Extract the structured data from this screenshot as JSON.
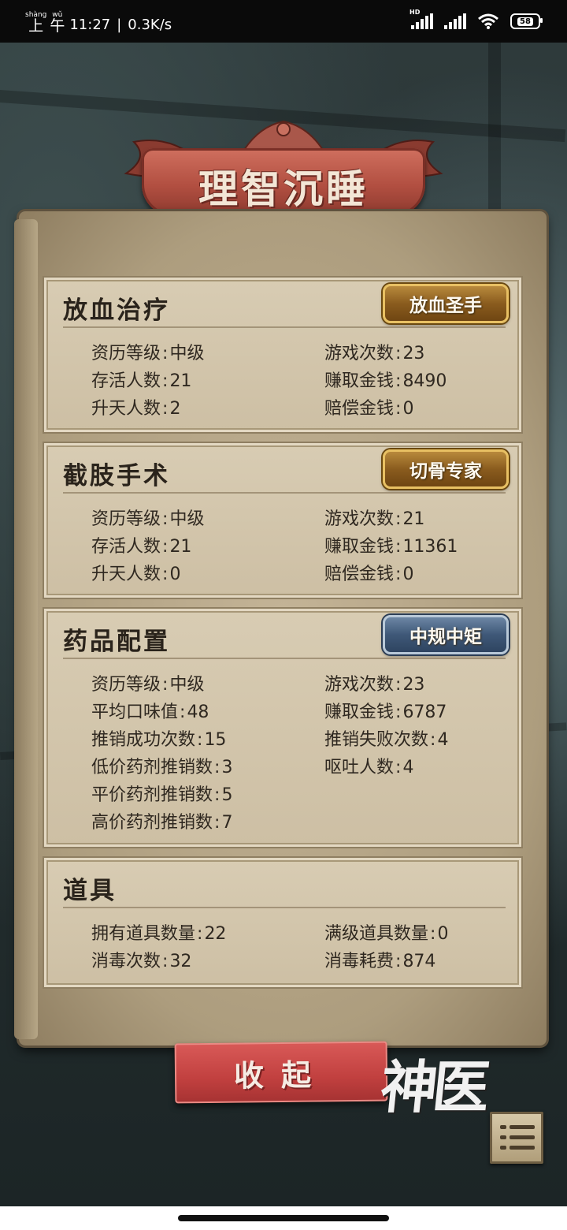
{
  "status_bar": {
    "pinyin_shang": "shàng",
    "pinyin_wu": "wǔ",
    "char_shang": "上",
    "char_wu": "午",
    "time": "11:27",
    "speed": "0.3K/s",
    "hd": "HD",
    "battery": "58"
  },
  "title": "理智沉睡",
  "panels": [
    {
      "title": "放血治疗",
      "badge": "放血圣手",
      "badge_style": "gold",
      "stats": [
        {
          "label": "资历等级",
          "value": "中级"
        },
        {
          "label": "游戏次数",
          "value": "23"
        },
        {
          "label": "存活人数",
          "value": "21"
        },
        {
          "label": "赚取金钱",
          "value": "8490"
        },
        {
          "label": "升天人数",
          "value": "2"
        },
        {
          "label": "赔偿金钱",
          "value": "0"
        }
      ]
    },
    {
      "title": "截肢手术",
      "badge": "切骨专家",
      "badge_style": "gold",
      "stats": [
        {
          "label": "资历等级",
          "value": "中级"
        },
        {
          "label": "游戏次数",
          "value": "21"
        },
        {
          "label": "存活人数",
          "value": "21"
        },
        {
          "label": "赚取金钱",
          "value": "11361"
        },
        {
          "label": "升天人数",
          "value": "0"
        },
        {
          "label": "赔偿金钱",
          "value": "0"
        }
      ]
    },
    {
      "title": "药品配置",
      "badge": "中规中矩",
      "badge_style": "blue",
      "stats": [
        {
          "label": "资历等级",
          "value": "中级"
        },
        {
          "label": "游戏次数",
          "value": "23"
        },
        {
          "label": "平均口味值",
          "value": "48"
        },
        {
          "label": "赚取金钱",
          "value": "6787"
        },
        {
          "label": "推销成功次数",
          "value": "15"
        },
        {
          "label": "推销失败次数",
          "value": "4"
        },
        {
          "label": "低价药剂推销数",
          "value": "3"
        },
        {
          "label": "呕吐人数",
          "value": "4"
        },
        {
          "label": "平价药剂推销数",
          "value": "5"
        },
        {
          "label": "高价药剂推销数",
          "value": "7"
        }
      ]
    },
    {
      "title": "道具",
      "stats": [
        {
          "label": "拥有道具数量",
          "value": "22"
        },
        {
          "label": "满级道具数量",
          "value": "0"
        },
        {
          "label": "消毒次数",
          "value": "32"
        },
        {
          "label": "消毒耗费",
          "value": "874"
        }
      ]
    }
  ],
  "collapse_button": "收起",
  "brand_logo": "神医",
  "colors": {
    "gold_badge": "#8a5c1e",
    "blue_badge": "#3f5878",
    "collapse_button": "#c1403f",
    "parchment": "#c4b497",
    "title_banner": "#b24f41"
  },
  "icons": [
    "wifi-icon",
    "signal-icon",
    "battery-icon",
    "menu-list-icon"
  ]
}
